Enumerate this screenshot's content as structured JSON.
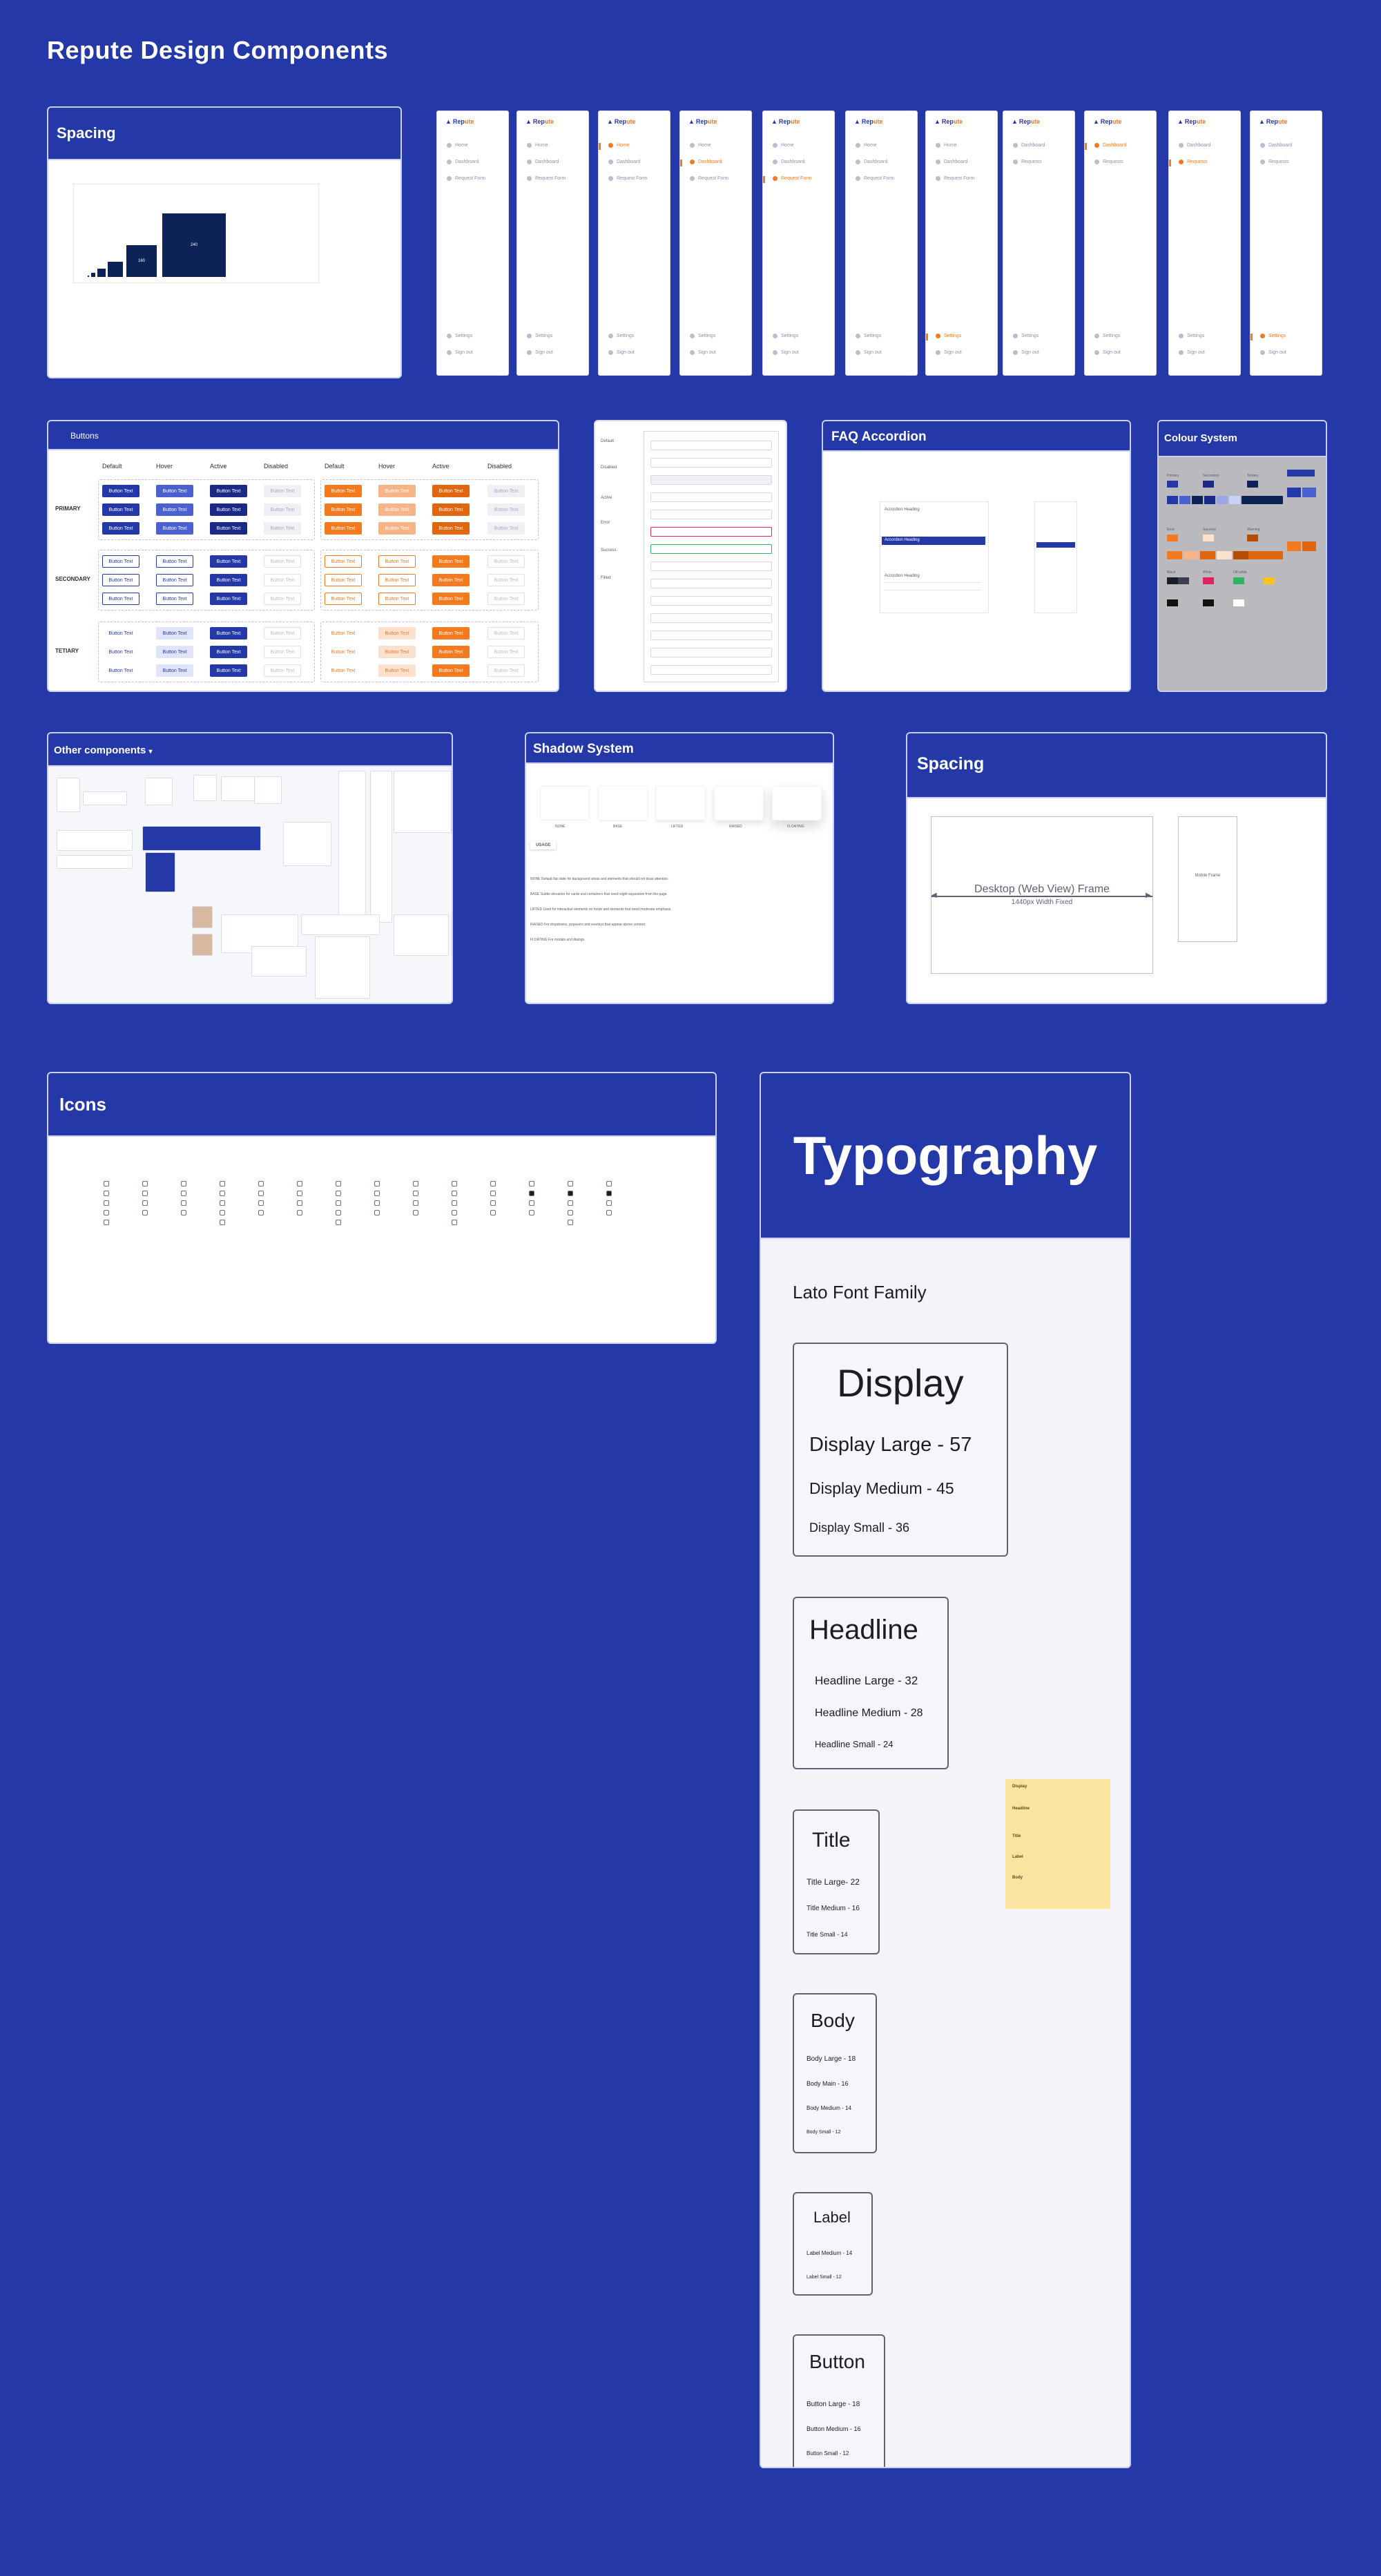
{
  "page": {
    "title": "Repute Design Components"
  },
  "spacing_top": {
    "title": "Spacing",
    "squares": [
      "",
      "",
      "",
      "",
      "160",
      "240"
    ]
  },
  "nav_frames": {
    "logo": "Rep",
    "logo_accent": "ute",
    "sets": [
      {
        "items": [
          "Home",
          "Dashboard",
          "Request Form"
        ],
        "bottom": [
          "Settings",
          "Sign out"
        ],
        "active": ""
      },
      {
        "items": [
          "Home",
          "Dashboard",
          "Request Form"
        ],
        "bottom": [
          "Settings",
          "Sign out"
        ],
        "active": ""
      },
      {
        "items": [
          "Home",
          "Dashboard",
          "Request Form"
        ],
        "bottom": [
          "Settings",
          "Sign out"
        ],
        "active": "Home"
      },
      {
        "items": [
          "Home",
          "Dashboard",
          "Request Form"
        ],
        "bottom": [
          "Settings",
          "Sign out"
        ],
        "active": "Dashboard"
      },
      {
        "items": [
          "Home",
          "Dashboard",
          "Request Form"
        ],
        "bottom": [
          "Settings",
          "Sign out"
        ],
        "active": "Request Form"
      },
      {
        "items": [
          "Home",
          "Dashboard",
          "Request Form"
        ],
        "bottom": [
          "Settings",
          "Sign out"
        ],
        "active": ""
      },
      {
        "items": [
          "Home",
          "Dashboard",
          "Request Form"
        ],
        "bottom": [
          "Settings",
          "Sign out"
        ],
        "active": "Settings"
      },
      {
        "items": [
          "Dashboard",
          "Requests"
        ],
        "bottom": [
          "Settings",
          "Sign out"
        ],
        "active": ""
      },
      {
        "items": [
          "Dashboard",
          "Requests"
        ],
        "bottom": [
          "Settings",
          "Sign out"
        ],
        "active": "Dashboard"
      },
      {
        "items": [
          "Dashboard",
          "Requests"
        ],
        "bottom": [
          "Settings",
          "Sign out"
        ],
        "active": "Requests"
      },
      {
        "items": [
          "Dashboard",
          "Requests"
        ],
        "bottom": [
          "Settings",
          "Sign out"
        ],
        "active": "Settings"
      }
    ]
  },
  "buttons": {
    "title": "Buttons",
    "columns": [
      "Default",
      "Hover",
      "Active",
      "Disabled",
      "Default",
      "Hover",
      "Active",
      "Disabled"
    ],
    "rows": [
      "PRIMARY",
      "SECONDARY",
      "TETIARY"
    ],
    "label": "Button Text"
  },
  "form_card": {
    "labels": [
      "Default",
      "Disabled",
      "Active",
      "Error",
      "Success",
      "Filled"
    ]
  },
  "faq": {
    "title": "FAQ Accordion",
    "items": [
      "Accordion Heading",
      "Accordion Heading",
      "Accordion Heading"
    ]
  },
  "colour": {
    "title": "Colour System",
    "groups": [
      "Primary",
      "Secondary",
      "Tertiary",
      "Error",
      "Success",
      "Warning",
      "Black",
      "White",
      "Off white"
    ],
    "colors": {
      "primary": [
        "#2438a8",
        "#4a62d0",
        "#0d2257",
        "#1b2a86",
        "#9aa7e6",
        "#c9d1f5"
      ],
      "secondary": [
        "#f47a20",
        "#f7b487",
        "#e06610",
        "#fde1cf",
        "#b54d05"
      ],
      "error": "#e0245e",
      "success": "#2fb463",
      "warning": "#f5c518",
      "black": "#111111",
      "white": "#ffffff"
    }
  },
  "other": {
    "title": "Other components"
  },
  "shadow": {
    "title": "Shadow System",
    "labels": [
      "NONE",
      "BASE",
      "LIFTED",
      "RAISED",
      "FLOATING"
    ],
    "tag": "USAGE",
    "rows": [
      "NONE     Default flat state for background areas and elements that should not draw attention.",
      "BASE     Subtle elevation for cards and containers that need slight separation from the page.",
      "LIFTED   Used for interactive elements on hover and elements that need moderate emphasis.",
      "RAISED   For dropdowns, popovers and overlays that appear above content.",
      "FLOATING For modals and dialogs."
    ]
  },
  "spacing_frames": {
    "title": "Spacing",
    "desktop_label": "Desktop (Web View) Frame",
    "desktop_sub": "1440px Width Fixed",
    "mobile_label": "Mobile Frame"
  },
  "icons": {
    "title": "Icons",
    "columns": 14
  },
  "typography": {
    "title": "Typography",
    "family": "Lato Font Family",
    "display": {
      "heading": "Display",
      "items": [
        "Display Large  - 57",
        "Display Medium  - 45",
        "Display Small  - 36"
      ]
    },
    "headline": {
      "heading": "Headline",
      "items": [
        "Headline Large  - 32",
        "Headline Medium  - 28",
        "Headline Small - 24"
      ]
    },
    "title_group": {
      "heading": "Title",
      "items": [
        "Title Large- 22",
        "Title Medium  - 16",
        "Title Small  - 14"
      ]
    },
    "body": {
      "heading": "Body",
      "items": [
        "Body Large  - 18",
        "Body Main  - 16",
        "Body Medium  - 14",
        "Body Small  - 12"
      ]
    },
    "label": {
      "heading": "Label",
      "items": [
        "Label Medium  - 14",
        "Label Small  - 12"
      ]
    },
    "button": {
      "heading": "Button",
      "items": [
        "Button Large  - 18",
        "Button Medium  - 16",
        "Button Small  - 12"
      ]
    },
    "note": {
      "heading": "Display",
      "lines": [
        "Headline",
        "Title",
        "Label",
        "Body"
      ]
    }
  }
}
